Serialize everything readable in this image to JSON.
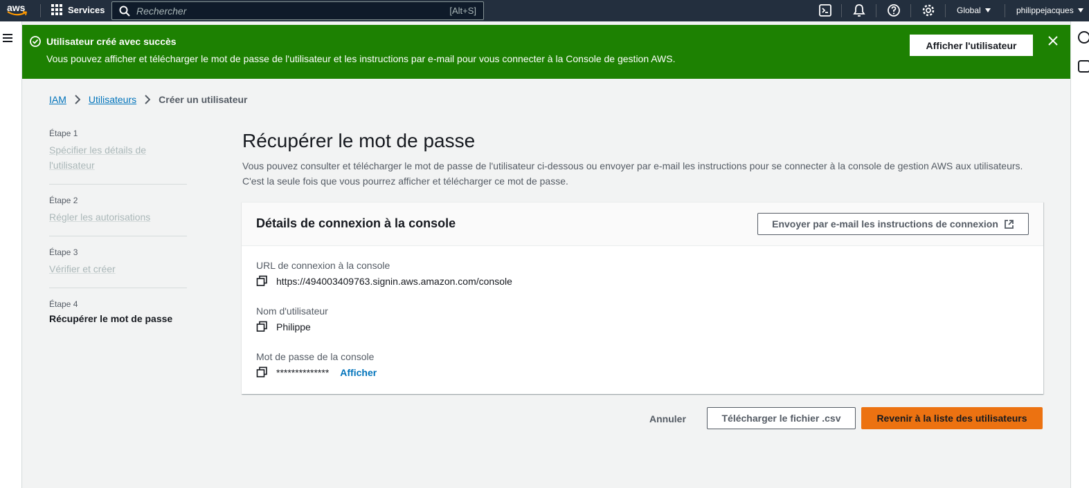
{
  "topnav": {
    "logo": "aws",
    "services_label": "Services",
    "search_placeholder": "Rechercher",
    "search_shortcut": "[Alt+S]",
    "icons": [
      "cloudshell-icon",
      "notifications-icon",
      "help-icon",
      "settings-icon"
    ],
    "region": "Global",
    "account": "philippejacques"
  },
  "flash": {
    "title": "Utilisateur créé avec succès",
    "message": "Vous pouvez afficher et télécharger le mot de passe de l'utilisateur et les instructions par e-mail pour vous connecter à la Console de gestion AWS.",
    "action_label": "Afficher l'utilisateur",
    "color": "#1d8102"
  },
  "breadcrumb": {
    "items": [
      "IAM",
      "Utilisateurs",
      "Créer un utilisateur"
    ]
  },
  "steps": [
    {
      "number": "Étape 1",
      "label": "Spécifier les détails de l'utilisateur"
    },
    {
      "number": "Étape 2",
      "label": "Régler les autorisations"
    },
    {
      "number": "Étape 3",
      "label": "Vérifier et créer"
    },
    {
      "number": "Étape 4",
      "label": "Récupérer le mot de passe"
    }
  ],
  "main": {
    "title": "Récupérer le mot de passe",
    "description_line1": "Vous pouvez consulter et télécharger le mot de passe de l'utilisateur ci-dessous ou envoyer par e-mail les instructions pour se connecter à la console de gestion AWS aux utilisateurs.",
    "description_line2": "C'est la seule fois que vous pourrez afficher et télécharger ce mot de passe."
  },
  "card": {
    "title": "Détails de connexion à la console",
    "email_button": "Envoyer par e-mail les instructions de connexion",
    "fields": [
      {
        "label": "URL de connexion à la console",
        "value": "https://494003409763.signin.aws.amazon.com/console"
      },
      {
        "label": "Nom d'utilisateur",
        "value": "Philippe"
      },
      {
        "label": "Mot de passe de la console",
        "value": "**************",
        "action": "Afficher"
      }
    ]
  },
  "footer": {
    "cancel": "Annuler",
    "download_csv": "Télécharger le fichier .csv",
    "return": "Revenir à la liste des utilisateurs",
    "primary_color": "#ec7211"
  }
}
